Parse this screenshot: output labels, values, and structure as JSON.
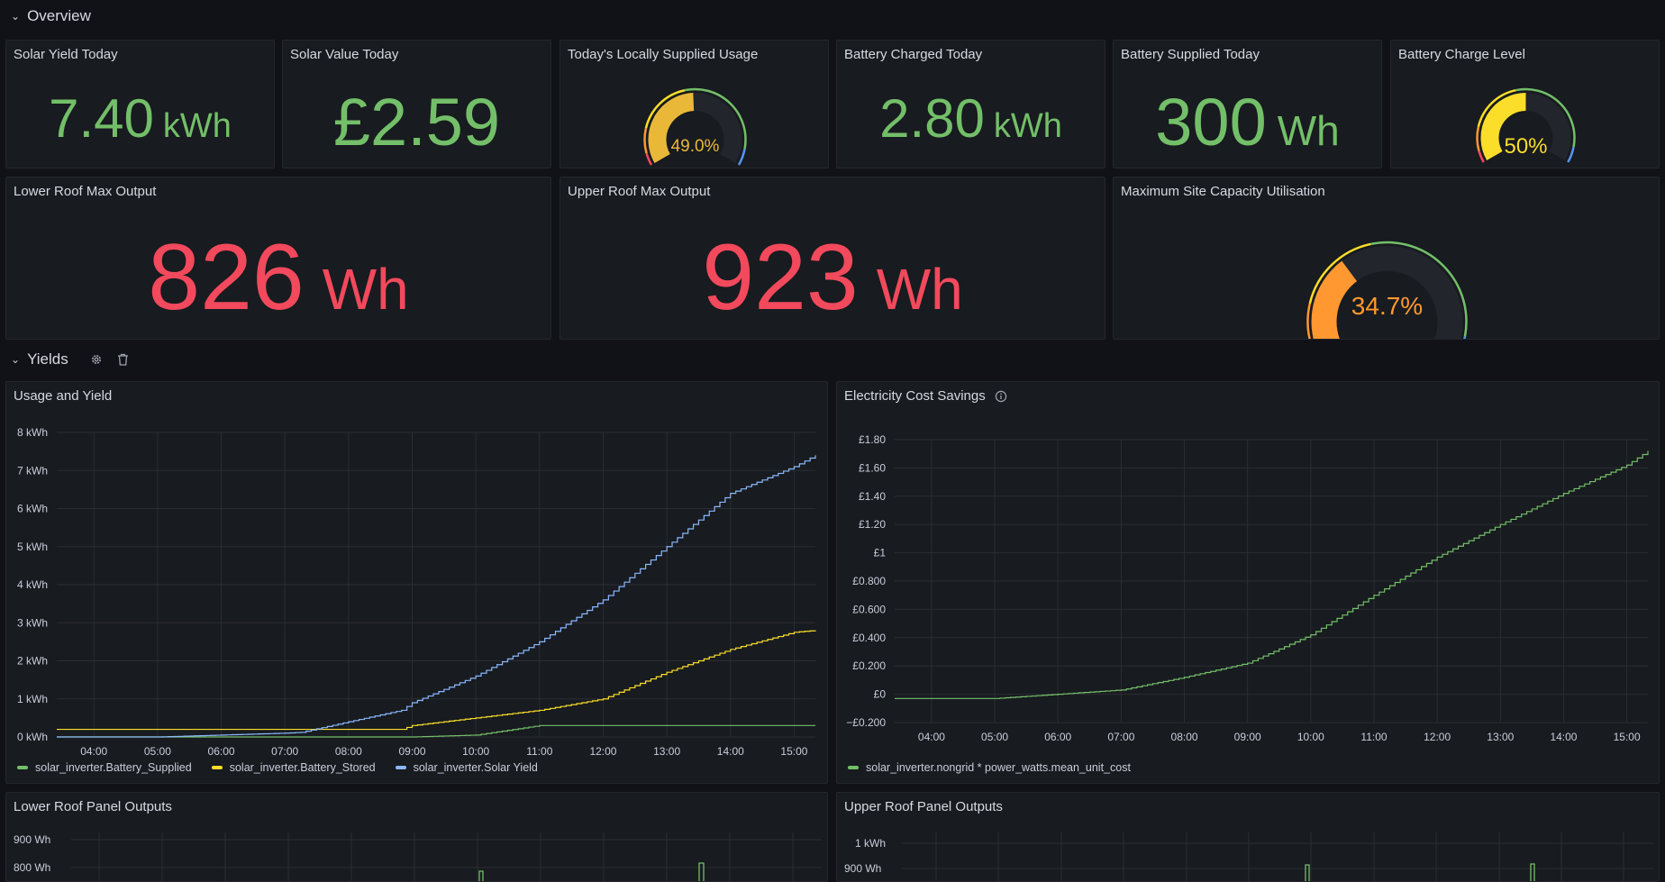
{
  "rows": {
    "overview": "Overview",
    "yields": "Yields"
  },
  "panels": {
    "solar_yield": {
      "title": "Solar Yield Today",
      "value": "7.40",
      "unit": "kWh"
    },
    "solar_value": {
      "title": "Solar Value Today",
      "value": "£2.59",
      "unit": ""
    },
    "locally_supplied": {
      "title": "Today's Locally Supplied Usage",
      "value_text": "49.0%",
      "value": 49.0,
      "color": "#eab839"
    },
    "battery_charged": {
      "title": "Battery Charged Today",
      "value": "2.80",
      "unit": "kWh"
    },
    "battery_supplied": {
      "title": "Battery Supplied Today",
      "value": "300",
      "unit": "Wh"
    },
    "battery_level": {
      "title": "Battery Charge Level",
      "value_text": "50%",
      "value": 50,
      "color": "#fade2a"
    },
    "lower_roof_max": {
      "title": "Lower Roof Max Output",
      "value": "826",
      "unit": "Wh"
    },
    "upper_roof_max": {
      "title": "Upper Roof Max Output",
      "value": "923",
      "unit": "Wh"
    },
    "site_capacity": {
      "title": "Maximum Site Capacity Utilisation",
      "value_text": "34.7%",
      "value": 34.7,
      "color": "#ff9830"
    },
    "usage_yield": {
      "title": "Usage and Yield"
    },
    "cost_savings": {
      "title": "Electricity Cost Savings"
    },
    "lower_roof_outputs": {
      "title": "Lower Roof Panel Outputs",
      "tick_labels": [
        "900 Wh",
        "800 Wh"
      ]
    },
    "upper_roof_outputs": {
      "title": "Upper Roof Panel Outputs",
      "tick_labels": [
        "1 kWh",
        "900 Wh"
      ]
    }
  },
  "colors": {
    "green": "#73bf69",
    "yellow": "#fade2a",
    "blue": "#8ab8ff",
    "red": "#f2495c",
    "orange": "#ff9830",
    "background": "#111217",
    "panel": "#181b1f"
  },
  "icons": [
    "gear-icon",
    "trash-icon",
    "info-icon",
    "chevron-down-icon"
  ],
  "chart_data": [
    {
      "type": "line",
      "title": "Usage and Yield",
      "x": [
        "03:25",
        "04:00",
        "05:00",
        "06:00",
        "07:00",
        "07:15",
        "08:00",
        "08:50",
        "09:00",
        "10:00",
        "11:00",
        "12:00",
        "13:00",
        "14:00",
        "15:00",
        "15:20"
      ],
      "x_ticks": [
        "04:00",
        "05:00",
        "06:00",
        "07:00",
        "08:00",
        "09:00",
        "10:00",
        "11:00",
        "12:00",
        "13:00",
        "14:00",
        "15:00"
      ],
      "y_ticks": [
        "0 kWh",
        "1 kWh",
        "2 kWh",
        "3 kWh",
        "4 kWh",
        "5 kWh",
        "6 kWh",
        "7 kWh",
        "8 kWh"
      ],
      "ylim": [
        0,
        8
      ],
      "grid": true,
      "legend": "bottom-left",
      "series": [
        {
          "name": "solar_inverter.Battery_Supplied",
          "color": "#73bf69",
          "values": [
            0.0,
            0.0,
            0.0,
            0.0,
            0.0,
            0.0,
            0.0,
            0.0,
            0.0,
            0.05,
            0.3,
            0.3,
            0.3,
            0.3,
            0.3,
            0.3
          ]
        },
        {
          "name": "solar_inverter.Battery_Stored",
          "color": "#fade2a",
          "values": [
            0.2,
            0.2,
            0.2,
            0.2,
            0.2,
            0.2,
            0.2,
            0.2,
            0.3,
            0.5,
            0.7,
            1.0,
            1.7,
            2.3,
            2.75,
            2.8
          ]
        },
        {
          "name": "solar_inverter.Solar Yield",
          "color": "#8ab8ff",
          "values": [
            0.0,
            0.0,
            0.0,
            0.05,
            0.1,
            0.12,
            0.4,
            0.7,
            0.9,
            1.6,
            2.5,
            3.6,
            5.0,
            6.4,
            7.1,
            7.4
          ]
        }
      ]
    },
    {
      "type": "line",
      "title": "Electricity Cost Savings",
      "x": [
        "03:25",
        "04:00",
        "05:00",
        "06:00",
        "07:00",
        "08:00",
        "09:00",
        "10:00",
        "11:00",
        "12:00",
        "13:00",
        "14:00",
        "15:00",
        "15:20"
      ],
      "x_ticks": [
        "04:00",
        "05:00",
        "06:00",
        "07:00",
        "08:00",
        "09:00",
        "10:00",
        "11:00",
        "12:00",
        "13:00",
        "14:00",
        "15:00"
      ],
      "y_ticks": [
        "−£0.200",
        "£0",
        "£0.200",
        "£0.400",
        "£0.600",
        "£0.800",
        "£1",
        "£1.20",
        "£1.40",
        "£1.60",
        "£1.80"
      ],
      "ylim": [
        -0.2,
        1.8
      ],
      "grid": true,
      "legend": "bottom-left",
      "series": [
        {
          "name": "solar_inverter.nongrid * power_watts.mean_unit_cost",
          "color": "#73bf69",
          "values": [
            -0.03,
            -0.03,
            -0.03,
            0.0,
            0.03,
            0.12,
            0.22,
            0.42,
            0.7,
            0.97,
            1.2,
            1.42,
            1.62,
            1.72
          ]
        }
      ]
    }
  ]
}
